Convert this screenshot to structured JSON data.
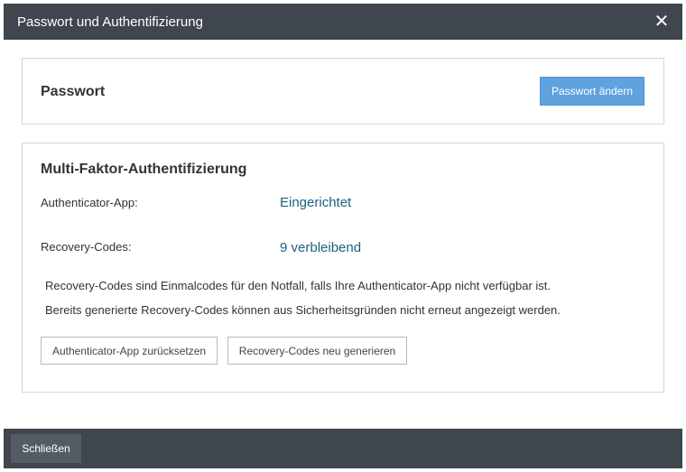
{
  "dialog": {
    "title": "Passwort und Authentifizierung",
    "close_glyph": "✕"
  },
  "password_panel": {
    "heading": "Passwort",
    "change_button": "Passwort ändern"
  },
  "mfa_panel": {
    "heading": "Multi-Faktor-Authentifizierung",
    "authenticator_label": "Authenticator-App:",
    "authenticator_value": "Eingerichtet",
    "recovery_label": "Recovery-Codes:",
    "recovery_value": "9 verbleibend",
    "info_line1": "Recovery-Codes sind Einmalcodes für den Notfall, falls Ihre Authenticator-App nicht verfügbar ist.",
    "info_line2": "Bereits generierte Recovery-Codes können aus Sicherheitsgründen nicht erneut angezeigt werden.",
    "reset_button": "Authenticator-App zurücksetzen",
    "regenerate_button": "Recovery-Codes neu generieren"
  },
  "footer": {
    "close_button": "Schließen"
  },
  "colors": {
    "header_bg": "#3f464d",
    "primary_button": "#5fa2dd",
    "value_text": "#1d5f82"
  }
}
